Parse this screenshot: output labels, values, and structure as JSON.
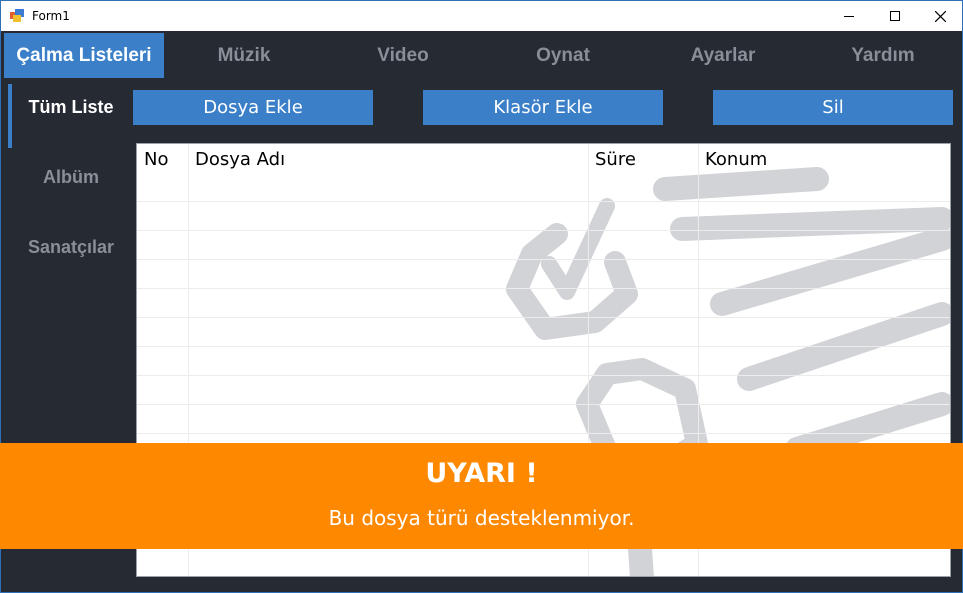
{
  "window": {
    "title": "Form1"
  },
  "topnav": {
    "tabs": [
      {
        "label": "Çalma Listeleri",
        "active": true
      },
      {
        "label": "Müzik",
        "active": false
      },
      {
        "label": "Video",
        "active": false
      },
      {
        "label": "Oynat",
        "active": false
      },
      {
        "label": "Ayarlar",
        "active": false
      },
      {
        "label": "Yardım",
        "active": false
      }
    ]
  },
  "sidebar": {
    "items": [
      {
        "label": "Tüm Liste",
        "active": true
      },
      {
        "label": "Albüm",
        "active": false
      },
      {
        "label": "Sanatçılar",
        "active": false
      }
    ]
  },
  "toolbar": {
    "add_file_label": "Dosya Ekle",
    "add_folder_label": "Klasör Ekle",
    "delete_label": "Sil"
  },
  "list": {
    "columns": [
      "No",
      "Dosya Adı",
      "Süre",
      "Konum"
    ],
    "rows": []
  },
  "alert": {
    "title": "UYARI !",
    "message": "Bu dosya türü desteklenmiyor."
  },
  "colors": {
    "accent": "#3a7fc8",
    "background": "#252a33",
    "warning": "#fe8800"
  }
}
